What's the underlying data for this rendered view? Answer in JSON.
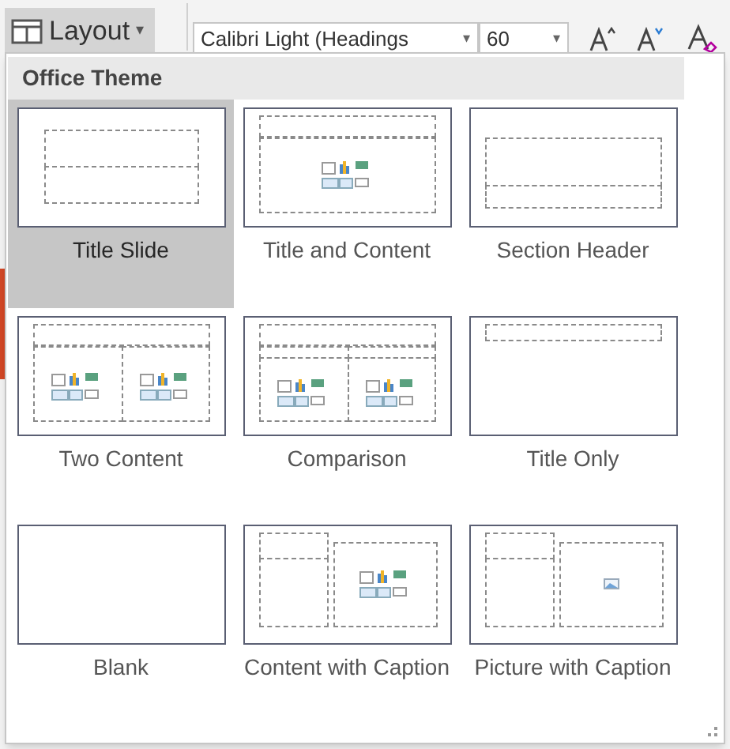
{
  "ribbon": {
    "layout_button": {
      "label": "Layout",
      "caret": "▾"
    },
    "font_name": {
      "value": "Calibri Light (Headings",
      "caret": "▾"
    },
    "font_size": {
      "value": "60",
      "caret": "▾"
    }
  },
  "gallery": {
    "title": "Office Theme",
    "layouts": [
      {
        "label": "Title Slide",
        "kind": "title",
        "selected": true
      },
      {
        "label": "Title and Content",
        "kind": "title-content",
        "selected": false
      },
      {
        "label": "Section Header",
        "kind": "section",
        "selected": false
      },
      {
        "label": "Two Content",
        "kind": "two-content",
        "selected": false
      },
      {
        "label": "Comparison",
        "kind": "comparison",
        "selected": false
      },
      {
        "label": "Title Only",
        "kind": "title-only",
        "selected": false
      },
      {
        "label": "Blank",
        "kind": "blank",
        "selected": false
      },
      {
        "label": "Content with Caption",
        "kind": "content-caption",
        "selected": false
      },
      {
        "label": "Picture with Caption",
        "kind": "picture-caption",
        "selected": false
      }
    ]
  }
}
